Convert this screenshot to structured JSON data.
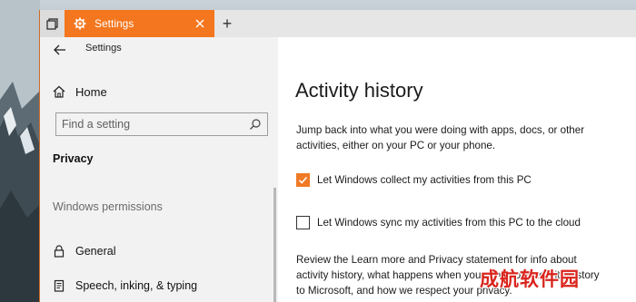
{
  "titlebar": {
    "tab_title": "Settings",
    "new_tab_glyph": "+",
    "accent": "#f4761e"
  },
  "sidebar": {
    "back_title": "Settings",
    "home_label": "Home",
    "search_placeholder": "Find a setting",
    "section_heading": "Privacy",
    "group_heading": "Windows permissions",
    "items": [
      {
        "label": "General",
        "icon": "lock-icon"
      },
      {
        "label": "Speech, inking, & typing",
        "icon": "document-icon"
      }
    ]
  },
  "content": {
    "title": "Activity history",
    "description": "Jump back into what you were doing with apps, docs, or other activities, either on your PC or your phone.",
    "checkboxes": [
      {
        "label": "Let Windows collect my activities from this PC",
        "checked": true
      },
      {
        "label": "Let Windows sync my activities from this PC to the cloud",
        "checked": false
      }
    ],
    "review_text": "Review the Learn more and Privacy statement for info about activity history, what happens when you send your activity history to Microsoft, and how we respect your privacy."
  },
  "watermark": "成航软件园"
}
